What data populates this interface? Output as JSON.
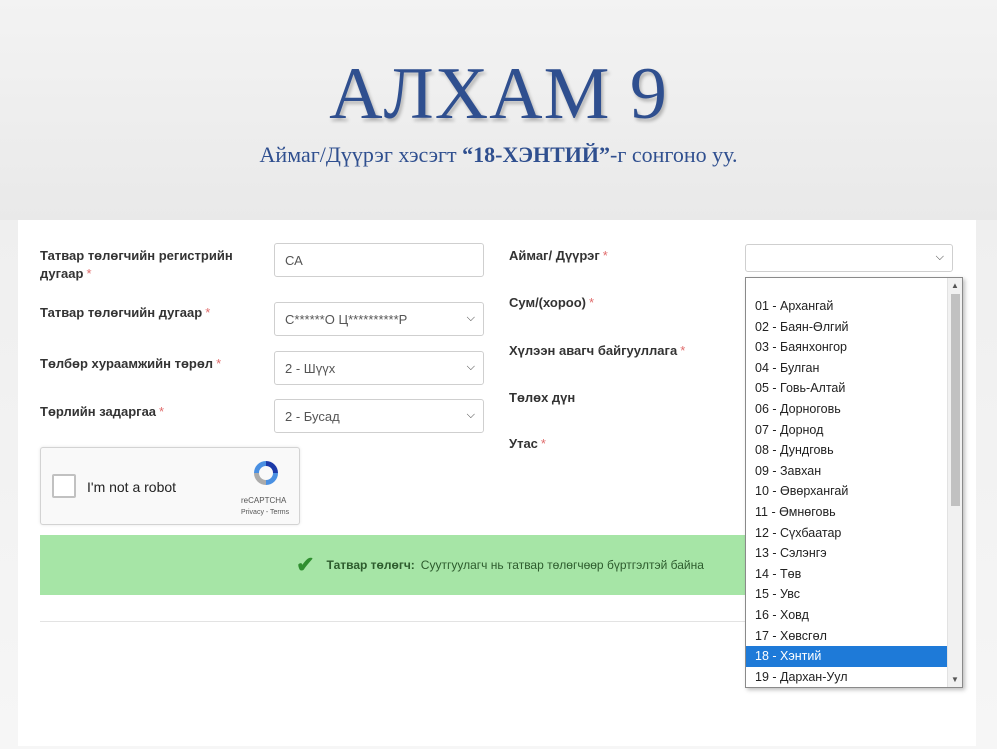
{
  "slide": {
    "title": "АЛХАМ 9",
    "subtitle_pre": "Аймаг/Дүүрэг хэсэгт ",
    "subtitle_bold": "“18-ХЭНТИЙ”",
    "subtitle_post": "-г сонгоно уу."
  },
  "form": {
    "left": {
      "reg_label": "Татвар төлөгчийн регистрийн дугаар",
      "reg_value": "СА",
      "taxpayer_label": "Татвар төлөгчийн дугаар",
      "taxpayer_value": "С******О Ц**********Р",
      "payment_type_label": "Төлбөр хураамжийн төрөл",
      "payment_type_value": "2 - Шүүх",
      "expense_label": "Төрлийн задаргаа",
      "expense_value": "2 - Бусад"
    },
    "right": {
      "district_label": "Аймаг/ Дүүрэг",
      "district_value": "",
      "sum_label": "Сум/(хороо)",
      "org_label": "Хүлээн авагч байгууллага",
      "amount_label": "Төлөх дүн",
      "phone_label": "Утас"
    },
    "required_mark": "*"
  },
  "recaptcha": {
    "label": "I'm not a robot",
    "brand": "reCAPTCHA",
    "links": "Privacy - Terms"
  },
  "status": {
    "key": "Татвар төлөгч:",
    "message": "Суутгуулагч нь татвар төлөгчөөр бүртгэлтэй байна"
  },
  "dropdown": {
    "selected_index": 17,
    "options": [
      "01 - Архангай",
      "02 - Баян-Өлгий",
      "03 - Баянхонгор",
      "04 - Булган",
      "05 - Говь-Алтай",
      "06 - Дорноговь",
      "07 - Дорнод",
      "08 - Дундговь",
      "09 - Завхан",
      "10 - Өвөрхангай",
      "11 - Өмнөговь",
      "12 - Сүхбаатар",
      "13 - Сэлэнгэ",
      "14 - Төв",
      "15 - Увс",
      "16 - Ховд",
      "17 - Хөвсгөл",
      "18 - Хэнтий",
      "19 - Дархан-Уул"
    ]
  },
  "colors": {
    "title": "#2f4f8f",
    "success_bg": "#a6e5a6",
    "selected_option": "#1e7ad8"
  }
}
